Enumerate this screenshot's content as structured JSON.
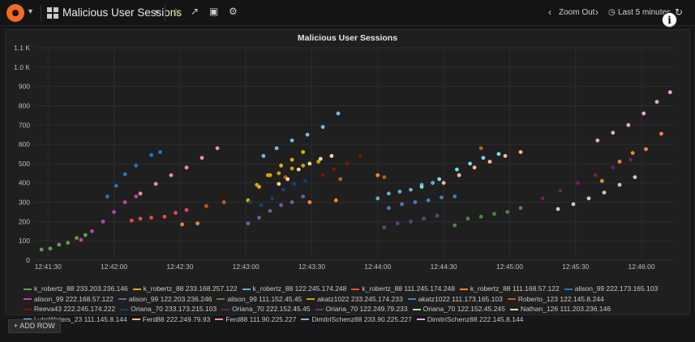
{
  "toolbar": {
    "dashboard_title": "Malicious User Sessions",
    "zoom_out_label": "Zoom Out",
    "time_range_label": "Last 5 minutes",
    "info_label": "i"
  },
  "panel": {
    "title": "Malicious User Sessions"
  },
  "add_row_label": "+ ADD ROW",
  "chart_data": {
    "type": "scatter",
    "title": "Malicious User Sessions",
    "xlabel": "",
    "ylabel": "",
    "x_tick_labels": [
      "12:41:30",
      "12:42:00",
      "12:42:30",
      "12:43:00",
      "12:43:30",
      "12:44:00",
      "12:44:30",
      "12:45:00",
      "12:45:30",
      "12:46:00"
    ],
    "y_tick_labels": [
      "0",
      "100",
      "200",
      "300",
      "400",
      "500",
      "600",
      "700",
      "800",
      "900",
      "1.0 K",
      "1.1 K"
    ],
    "xlim": [
      "12:41:24",
      "12:46:14"
    ],
    "ylim": [
      0,
      1100
    ],
    "grid": true,
    "legend_position": "bottom",
    "series": [
      {
        "name": "k_robertz_88 233.203.236.146",
        "color": "#629e51",
        "points": [
          [
            "12:41:27",
            55
          ],
          [
            "12:41:31",
            60
          ],
          [
            "12:41:35",
            80
          ],
          [
            "12:41:39",
            90
          ],
          [
            "12:41:43",
            115
          ],
          [
            "12:41:47",
            130
          ]
        ]
      },
      {
        "name": "k_robertz_88 233.168.257.122",
        "color": "#e5ac0e",
        "points": [
          [
            "12:43:01",
            310
          ],
          [
            "12:43:06",
            380
          ],
          [
            "12:43:11",
            440
          ],
          [
            "12:43:16",
            490
          ],
          [
            "12:43:21",
            520
          ],
          [
            "12:43:26",
            560
          ]
        ]
      },
      {
        "name": "k_robertz_88 122.245.174.248",
        "color": "#64b0c8",
        "points": [
          [
            "12:44:00",
            320
          ],
          [
            "12:44:05",
            345
          ],
          [
            "12:44:10",
            355
          ],
          [
            "12:44:15",
            365
          ],
          [
            "12:44:20",
            390
          ],
          [
            "12:44:25",
            400
          ]
        ]
      },
      {
        "name": "k_robertz_88 111.245.174.248",
        "color": "#e24d42",
        "points": [
          [
            "12:42:08",
            205
          ],
          [
            "12:42:12",
            215
          ],
          [
            "12:42:17",
            220
          ],
          [
            "12:42:23",
            225
          ],
          [
            "12:42:28",
            245
          ],
          [
            "12:42:33",
            260
          ]
        ]
      },
      {
        "name": "k_robertz_88 111.168.57.122",
        "color": "#ef843c",
        "points": [
          [
            "12:42:31",
            185
          ],
          [
            "12:42:38",
            190
          ],
          [
            "12:43:29",
            300
          ],
          [
            "12:43:41",
            310
          ],
          [
            "12:44:00",
            440
          ],
          [
            "12:45:42",
            410
          ],
          [
            "12:45:50",
            510
          ],
          [
            "12:45:56",
            555
          ],
          [
            "12:46:02",
            575
          ],
          [
            "12:46:09",
            655
          ]
        ]
      },
      {
        "name": "alison_99 222.173.165.103",
        "color": "#1f78c1",
        "points": [
          [
            "12:41:57",
            330
          ],
          [
            "12:42:01",
            385
          ],
          [
            "12:42:05",
            445
          ],
          [
            "12:42:10",
            490
          ],
          [
            "12:42:17",
            545
          ],
          [
            "12:42:21",
            560
          ]
        ]
      },
      {
        "name": "alison_99 222.168.57.122",
        "color": "#ba43a9",
        "points": [
          [
            "12:41:45",
            105
          ],
          [
            "12:41:50",
            150
          ],
          [
            "12:41:55",
            200
          ],
          [
            "12:42:00",
            250
          ],
          [
            "12:42:05",
            300
          ],
          [
            "12:42:10",
            330
          ]
        ]
      },
      {
        "name": "alison_99 122.203.236.246",
        "color": "#705da0",
        "points": [
          [
            "12:43:01",
            190
          ],
          [
            "12:43:06",
            220
          ],
          [
            "12:43:11",
            255
          ],
          [
            "12:43:16",
            285
          ],
          [
            "12:43:21",
            300
          ],
          [
            "12:43:26",
            330
          ]
        ]
      },
      {
        "name": "alison_99 111.152.45.45",
        "color": "#508642",
        "points": [
          [
            "12:44:35",
            180
          ],
          [
            "12:44:41",
            215
          ],
          [
            "12:44:47",
            225
          ],
          [
            "12:44:53",
            240
          ],
          [
            "12:44:59",
            250
          ],
          [
            "12:45:05",
            270
          ]
        ]
      },
      {
        "name": "akatz1022 233.245.174.233",
        "color": "#cca300",
        "points": [
          [
            "12:43:05",
            390
          ],
          [
            "12:43:10",
            440
          ],
          [
            "12:43:15",
            450
          ],
          [
            "12:43:21",
            475
          ],
          [
            "12:43:26",
            490
          ],
          [
            "12:43:33",
            510
          ]
        ]
      },
      {
        "name": "akatz1022 111.173.165.103",
        "color": "#447ebc",
        "points": [
          [
            "12:44:05",
            270
          ],
          [
            "12:44:11",
            290
          ],
          [
            "12:44:17",
            300
          ],
          [
            "12:44:23",
            310
          ],
          [
            "12:44:29",
            325
          ],
          [
            "12:44:35",
            330
          ]
        ]
      },
      {
        "name": "Roberto_123 122.145.8.244",
        "color": "#c15c17",
        "points": [
          [
            "12:42:42",
            280
          ],
          [
            "12:42:50",
            300
          ],
          [
            "12:43:18",
            430
          ],
          [
            "12:43:43",
            420
          ],
          [
            "12:44:03",
            430
          ],
          [
            "12:44:47",
            580
          ]
        ]
      },
      {
        "name": "Reeva43 222.245.174.222",
        "color": "#890f02",
        "points": [
          [
            "12:43:35",
            440
          ],
          [
            "12:43:40",
            470
          ],
          [
            "12:43:46",
            500
          ],
          [
            "12:43:52",
            540
          ]
        ]
      },
      {
        "name": "Oriana_70 233.173.215.103",
        "color": "#0a437c",
        "points": [
          [
            "12:43:02",
            300
          ],
          [
            "12:43:07",
            285
          ],
          [
            "12:43:12",
            320
          ],
          [
            "12:43:17",
            365
          ],
          [
            "12:43:22",
            395
          ],
          [
            "12:43:27",
            410
          ]
        ]
      },
      {
        "name": "Oriana_70 222.152.45.45",
        "color": "#6d1f62",
        "points": [
          [
            "12:45:15",
            320
          ],
          [
            "12:45:23",
            360
          ],
          [
            "12:45:31",
            400
          ],
          [
            "12:45:39",
            440
          ],
          [
            "12:45:47",
            480
          ],
          [
            "12:45:55",
            520
          ]
        ]
      },
      {
        "name": "Oriana_70 122.249.79.233",
        "color": "#584477",
        "points": [
          [
            "12:44:03",
            170
          ],
          [
            "12:44:09",
            190
          ],
          [
            "12:44:15",
            200
          ],
          [
            "12:44:21",
            215
          ],
          [
            "12:44:27",
            230
          ]
        ]
      },
      {
        "name": "Oriana_70 122.152.45.245",
        "color": "#b7dbab",
        "points": [
          [
            "12:45:22",
            265
          ],
          [
            "12:45:29",
            290
          ],
          [
            "12:45:36",
            320
          ],
          [
            "12:45:43",
            350
          ],
          [
            "12:45:50",
            390
          ],
          [
            "12:45:57",
            430
          ]
        ]
      },
      {
        "name": "Nathan_126 111.203.236.146",
        "color": "#f4d598",
        "points": [
          [
            "12:43:15",
            395
          ],
          [
            "12:43:19",
            420
          ],
          [
            "12:43:24",
            470
          ],
          [
            "12:43:29",
            500
          ],
          [
            "12:43:34",
            525
          ],
          [
            "12:43:39",
            540
          ]
        ]
      },
      {
        "name": "LukeWaters_23 111.145.8.144",
        "color": "#70dbed",
        "points": [
          [
            "12:44:20",
            380
          ],
          [
            "12:44:28",
            420
          ],
          [
            "12:44:36",
            470
          ],
          [
            "12:44:42",
            500
          ],
          [
            "12:44:48",
            530
          ],
          [
            "12:44:55",
            550
          ]
        ]
      },
      {
        "name": "Ferd88 222.249.79.93",
        "color": "#f9ba8f",
        "points": [
          [
            "12:44:30",
            400
          ],
          [
            "12:44:37",
            440
          ],
          [
            "12:44:44",
            480
          ],
          [
            "12:44:51",
            510
          ],
          [
            "12:44:58",
            540
          ],
          [
            "12:45:05",
            560
          ]
        ]
      },
      {
        "name": "Ferd88 111.90.225.227",
        "color": "#f29191",
        "points": [
          [
            "12:42:12",
            345
          ],
          [
            "12:42:19",
            395
          ],
          [
            "12:42:26",
            440
          ],
          [
            "12:42:33",
            480
          ],
          [
            "12:42:40",
            530
          ],
          [
            "12:42:47",
            580
          ]
        ]
      },
      {
        "name": "DimitriSchenz88 233.90.225.227",
        "color": "#82b5d8",
        "points": [
          [
            "12:43:08",
            540
          ],
          [
            "12:43:14",
            580
          ],
          [
            "12:43:21",
            620
          ],
          [
            "12:43:28",
            650
          ],
          [
            "12:43:35",
            690
          ],
          [
            "12:43:42",
            760
          ]
        ]
      },
      {
        "name": "DimitriSchenz88 222.145.8.144",
        "color": "#e5a8e2",
        "points": [
          [
            "12:45:40",
            620
          ],
          [
            "12:45:47",
            660
          ],
          [
            "12:45:54",
            700
          ],
          [
            "12:46:01",
            760
          ],
          [
            "12:46:07",
            820
          ],
          [
            "12:46:13",
            870
          ]
        ]
      }
    ]
  }
}
